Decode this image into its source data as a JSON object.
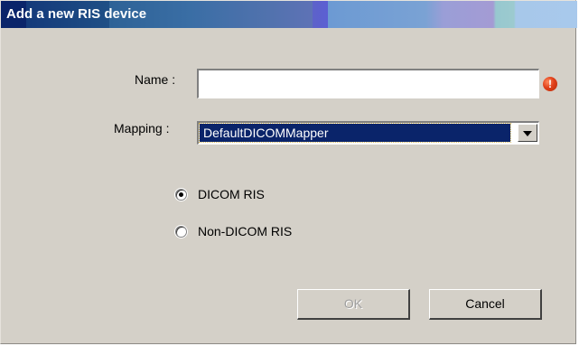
{
  "dialog": {
    "title": "Add a new RIS device",
    "name_label": "Name :",
    "name_value": "",
    "warning_icon": "warning-icon",
    "mapping_label": "Mapping :",
    "mapping_selected": "DefaultDICOMMapper",
    "radio_options": [
      {
        "label": "DICOM RIS",
        "selected": true
      },
      {
        "label": "Non-DICOM RIS",
        "selected": false
      }
    ],
    "ok_label": "OK",
    "ok_enabled": false,
    "cancel_label": "Cancel"
  },
  "colors": {
    "dialog_bg": "#d4d0c8",
    "title_text": "#ffffff",
    "selection_bg": "#0a246a",
    "warning": "#e0401a"
  }
}
